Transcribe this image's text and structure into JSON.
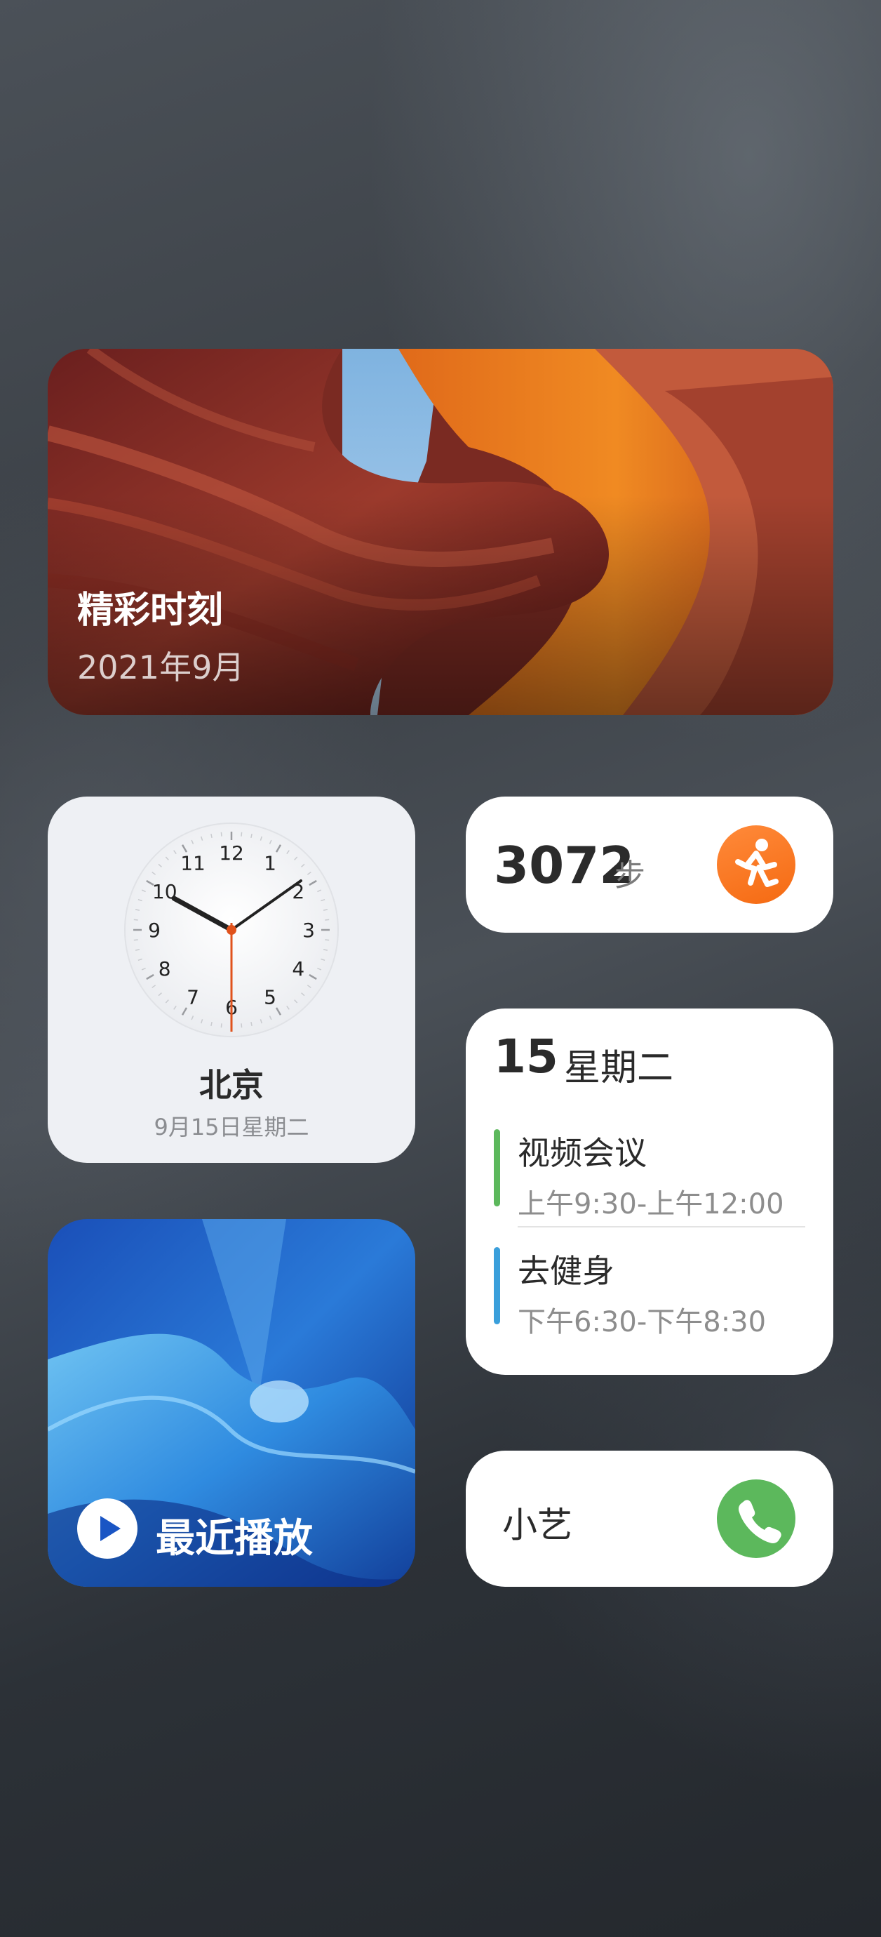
{
  "photo_widget": {
    "title": "精彩时刻",
    "subtitle": "2021年9月"
  },
  "clock_widget": {
    "city": "北京",
    "date": "9月15日星期二",
    "numerals": [
      "12",
      "1",
      "2",
      "3",
      "4",
      "5",
      "6",
      "7",
      "8",
      "9",
      "10",
      "11"
    ]
  },
  "steps_widget": {
    "count": "3072",
    "unit": "步",
    "icon": "running-icon",
    "accent": "#f7741c"
  },
  "calendar_widget": {
    "day": "15",
    "weekday": "星期二",
    "events": [
      {
        "title": "视频会议",
        "time": "上午9:30-上午12:00",
        "color": "#5cb85c"
      },
      {
        "title": "去健身",
        "time": "下午6:30-下午8:30",
        "color": "#3a9fdb"
      }
    ]
  },
  "music_widget": {
    "label": "最近播放",
    "icon": "play-icon"
  },
  "contact_widget": {
    "name": "小艺",
    "icon": "phone-icon",
    "accent": "#5cb85c"
  }
}
